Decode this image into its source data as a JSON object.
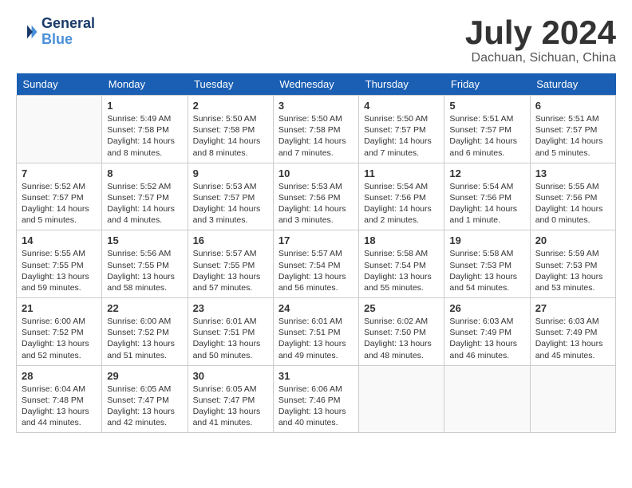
{
  "header": {
    "logo_line1": "General",
    "logo_line2": "Blue",
    "month_year": "July 2024",
    "location": "Dachuan, Sichuan, China"
  },
  "weekdays": [
    "Sunday",
    "Monday",
    "Tuesday",
    "Wednesday",
    "Thursday",
    "Friday",
    "Saturday"
  ],
  "weeks": [
    [
      {
        "day": "",
        "content": ""
      },
      {
        "day": "1",
        "content": "Sunrise: 5:49 AM\nSunset: 7:58 PM\nDaylight: 14 hours\nand 8 minutes."
      },
      {
        "day": "2",
        "content": "Sunrise: 5:50 AM\nSunset: 7:58 PM\nDaylight: 14 hours\nand 8 minutes."
      },
      {
        "day": "3",
        "content": "Sunrise: 5:50 AM\nSunset: 7:58 PM\nDaylight: 14 hours\nand 7 minutes."
      },
      {
        "day": "4",
        "content": "Sunrise: 5:50 AM\nSunset: 7:57 PM\nDaylight: 14 hours\nand 7 minutes."
      },
      {
        "day": "5",
        "content": "Sunrise: 5:51 AM\nSunset: 7:57 PM\nDaylight: 14 hours\nand 6 minutes."
      },
      {
        "day": "6",
        "content": "Sunrise: 5:51 AM\nSunset: 7:57 PM\nDaylight: 14 hours\nand 5 minutes."
      }
    ],
    [
      {
        "day": "7",
        "content": "Sunrise: 5:52 AM\nSunset: 7:57 PM\nDaylight: 14 hours\nand 5 minutes."
      },
      {
        "day": "8",
        "content": "Sunrise: 5:52 AM\nSunset: 7:57 PM\nDaylight: 14 hours\nand 4 minutes."
      },
      {
        "day": "9",
        "content": "Sunrise: 5:53 AM\nSunset: 7:57 PM\nDaylight: 14 hours\nand 3 minutes."
      },
      {
        "day": "10",
        "content": "Sunrise: 5:53 AM\nSunset: 7:56 PM\nDaylight: 14 hours\nand 3 minutes."
      },
      {
        "day": "11",
        "content": "Sunrise: 5:54 AM\nSunset: 7:56 PM\nDaylight: 14 hours\nand 2 minutes."
      },
      {
        "day": "12",
        "content": "Sunrise: 5:54 AM\nSunset: 7:56 PM\nDaylight: 14 hours\nand 1 minute."
      },
      {
        "day": "13",
        "content": "Sunrise: 5:55 AM\nSunset: 7:56 PM\nDaylight: 14 hours\nand 0 minutes."
      }
    ],
    [
      {
        "day": "14",
        "content": "Sunrise: 5:55 AM\nSunset: 7:55 PM\nDaylight: 13 hours\nand 59 minutes."
      },
      {
        "day": "15",
        "content": "Sunrise: 5:56 AM\nSunset: 7:55 PM\nDaylight: 13 hours\nand 58 minutes."
      },
      {
        "day": "16",
        "content": "Sunrise: 5:57 AM\nSunset: 7:55 PM\nDaylight: 13 hours\nand 57 minutes."
      },
      {
        "day": "17",
        "content": "Sunrise: 5:57 AM\nSunset: 7:54 PM\nDaylight: 13 hours\nand 56 minutes."
      },
      {
        "day": "18",
        "content": "Sunrise: 5:58 AM\nSunset: 7:54 PM\nDaylight: 13 hours\nand 55 minutes."
      },
      {
        "day": "19",
        "content": "Sunrise: 5:58 AM\nSunset: 7:53 PM\nDaylight: 13 hours\nand 54 minutes."
      },
      {
        "day": "20",
        "content": "Sunrise: 5:59 AM\nSunset: 7:53 PM\nDaylight: 13 hours\nand 53 minutes."
      }
    ],
    [
      {
        "day": "21",
        "content": "Sunrise: 6:00 AM\nSunset: 7:52 PM\nDaylight: 13 hours\nand 52 minutes."
      },
      {
        "day": "22",
        "content": "Sunrise: 6:00 AM\nSunset: 7:52 PM\nDaylight: 13 hours\nand 51 minutes."
      },
      {
        "day": "23",
        "content": "Sunrise: 6:01 AM\nSunset: 7:51 PM\nDaylight: 13 hours\nand 50 minutes."
      },
      {
        "day": "24",
        "content": "Sunrise: 6:01 AM\nSunset: 7:51 PM\nDaylight: 13 hours\nand 49 minutes."
      },
      {
        "day": "25",
        "content": "Sunrise: 6:02 AM\nSunset: 7:50 PM\nDaylight: 13 hours\nand 48 minutes."
      },
      {
        "day": "26",
        "content": "Sunrise: 6:03 AM\nSunset: 7:49 PM\nDaylight: 13 hours\nand 46 minutes."
      },
      {
        "day": "27",
        "content": "Sunrise: 6:03 AM\nSunset: 7:49 PM\nDaylight: 13 hours\nand 45 minutes."
      }
    ],
    [
      {
        "day": "28",
        "content": "Sunrise: 6:04 AM\nSunset: 7:48 PM\nDaylight: 13 hours\nand 44 minutes."
      },
      {
        "day": "29",
        "content": "Sunrise: 6:05 AM\nSunset: 7:47 PM\nDaylight: 13 hours\nand 42 minutes."
      },
      {
        "day": "30",
        "content": "Sunrise: 6:05 AM\nSunset: 7:47 PM\nDaylight: 13 hours\nand 41 minutes."
      },
      {
        "day": "31",
        "content": "Sunrise: 6:06 AM\nSunset: 7:46 PM\nDaylight: 13 hours\nand 40 minutes."
      },
      {
        "day": "",
        "content": ""
      },
      {
        "day": "",
        "content": ""
      },
      {
        "day": "",
        "content": ""
      }
    ]
  ]
}
